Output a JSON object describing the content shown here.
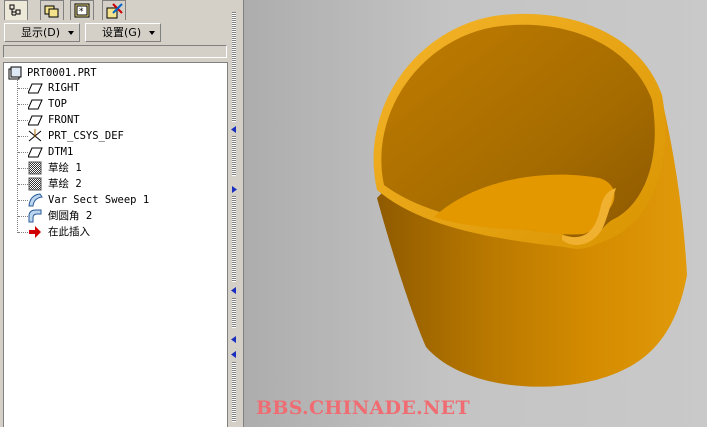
{
  "navigator": {
    "tabs": [
      {
        "icon": "model-tree-icon"
      },
      {
        "icon": "folder-browser-icon"
      },
      {
        "icon": "favorites-icon"
      },
      {
        "icon": "connections-icon"
      }
    ],
    "menus": {
      "show_label": "显示(D)",
      "settings_label": "设置(G)"
    },
    "tree": {
      "root": "PRT0001.PRT",
      "items": [
        {
          "label": "RIGHT",
          "icon": "datum-plane-icon"
        },
        {
          "label": "TOP",
          "icon": "datum-plane-icon"
        },
        {
          "label": "FRONT",
          "icon": "datum-plane-icon"
        },
        {
          "label": "PRT_CSYS_DEF",
          "icon": "coordinate-system-icon"
        },
        {
          "label": "DTM1",
          "icon": "datum-plane-icon"
        },
        {
          "label": "草绘 1",
          "icon": "sketch-icon"
        },
        {
          "label": "草绘 2",
          "icon": "sketch-icon"
        },
        {
          "label": "Var Sect Sweep 1",
          "icon": "sweep-icon"
        },
        {
          "label": "倒圆角 2",
          "icon": "round-icon"
        },
        {
          "label": "在此插入",
          "icon": "insert-here-arrow-icon"
        }
      ]
    }
  },
  "viewport": {
    "model": "orange-cup-with-spout",
    "watermark": "BBS.CHINADE.NET"
  },
  "colors": {
    "model_light": "#f2ad1c",
    "model_mid": "#d08900",
    "model_dark": "#9e6200",
    "watermark": "#ef6d72",
    "insert_arrow": "#d10000",
    "splitter_arrow": "#1a2fbf"
  }
}
